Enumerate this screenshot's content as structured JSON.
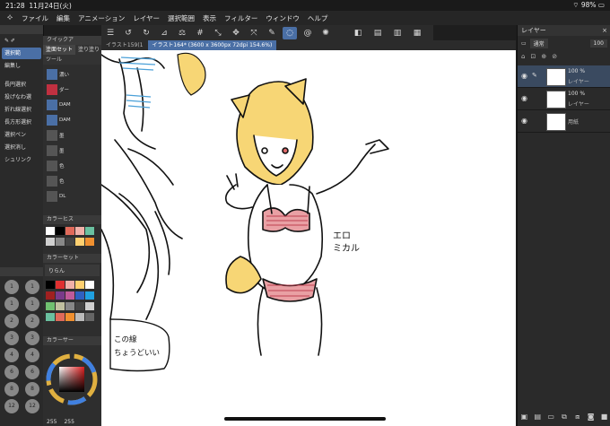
{
  "status": {
    "time": "21:28",
    "date": "11月24日(火)",
    "battery": "98%"
  },
  "menu": [
    "ファイル",
    "編集",
    "アニメーション",
    "レイヤー",
    "選択範囲",
    "表示",
    "フィルター",
    "ウィンドウ",
    "ヘルプ"
  ],
  "doc_tabs": [
    {
      "label": "イラスト159(1"
    },
    {
      "label": "イラスト164* (3600 x 3600px 72dpi 154.6%)"
    }
  ],
  "left_panel": {
    "tool_tabs": [
      "塗面セット",
      "塗り塗り",
      "ツール"
    ],
    "sub_header": "クイックア",
    "tools": [
      "選択範",
      "編集し",
      "長円選択",
      "投げなわ選",
      "折れ線選択",
      "長方形選択",
      "選択ペン",
      "選択消し",
      "シュリンク"
    ],
    "brushes": [
      {
        "icon": "濃い",
        "label": "濃い"
      },
      {
        "icon": "DAM",
        "label": "DAM"
      },
      {
        "icon": "DAM",
        "label": "DAM"
      },
      {
        "icon": "ダー",
        "label": "ダー"
      },
      {
        "icon": "消",
        "label": "消し"
      }
    ],
    "brush_extra": [
      "墨",
      "墨",
      "色",
      "色",
      "DL"
    ],
    "color_history_label": "カラーヒス",
    "color_set_label": "カラーセット",
    "color_set_name": "りらん",
    "color_wheel_label": "カラーサー",
    "rgb_value_1": "255",
    "rgb_value_2": "255",
    "brush_sizes": [
      "1",
      "1",
      "1",
      "1",
      "2",
      "2",
      "3",
      "3",
      "4",
      "4",
      "6",
      "6",
      "8",
      "8",
      "12",
      "12"
    ]
  },
  "layer_panel": {
    "title": "レイヤー",
    "blend_mode": "通常",
    "opacity": "100",
    "layers": [
      {
        "percent": "100 %",
        "name": "レイヤー",
        "selected": true
      },
      {
        "percent": "100 %",
        "name": "レイヤー",
        "selected": false
      },
      {
        "percent": "",
        "name": "用紙",
        "selected": false
      }
    ]
  },
  "canvas_text": {
    "note_line1": "この線",
    "note_line2": "ちょうどいい",
    "handwriting_line1": "エロ",
    "handwriting_line2": "ミカル"
  },
  "colors": {
    "accent": "#4a6fa5",
    "hair": "#f7d675",
    "bikini": "#e9a0a4",
    "swatches": [
      "#ffffff",
      "#000000",
      "#e06a5a",
      "#f0b0a8",
      "#6ac0a0",
      "#d0d0d0",
      "#888888",
      "#444444",
      "#e03030",
      "#a02020",
      "#7a3a8a",
      "#c05a9a",
      "#3060c0",
      "#20a0e0",
      "#70c070",
      "#c0c0a0",
      "#ffd070",
      "#f09030"
    ]
  }
}
